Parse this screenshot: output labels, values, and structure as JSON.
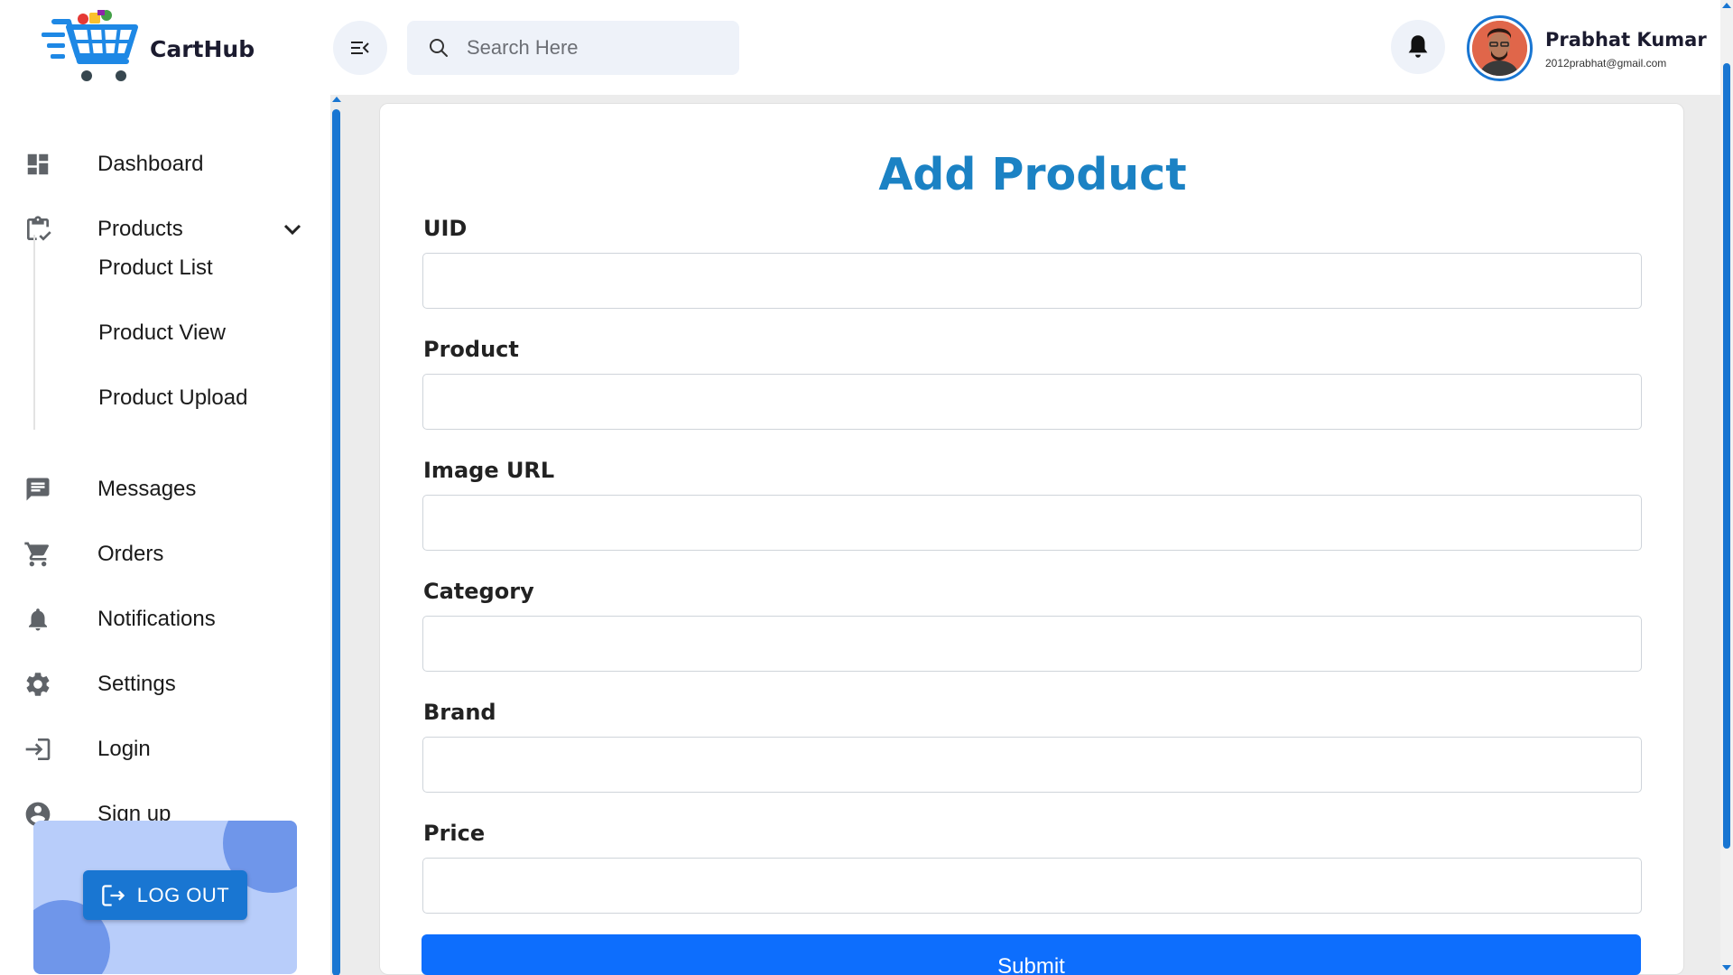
{
  "app": {
    "brand": "CartHub"
  },
  "header": {
    "search_placeholder": "Search Here",
    "user": {
      "name": "Prabhat Kumar",
      "email": "2012prabhat@gmail.com"
    }
  },
  "sidebar": {
    "items": [
      {
        "label": "Dashboard",
        "icon": "dashboard-icon"
      },
      {
        "label": "Products",
        "icon": "clipboard-check-icon",
        "expanded": true
      },
      {
        "label": "Messages",
        "icon": "message-icon"
      },
      {
        "label": "Orders",
        "icon": "cart-icon"
      },
      {
        "label": "Notifications",
        "icon": "bell-icon"
      },
      {
        "label": "Settings",
        "icon": "gear-icon"
      },
      {
        "label": "Login",
        "icon": "login-icon"
      },
      {
        "label": "Sign up",
        "icon": "account-circle-icon"
      }
    ],
    "submenu": [
      {
        "label": "Product List"
      },
      {
        "label": "Product View"
      },
      {
        "label": "Product Upload"
      }
    ],
    "logout_label": "LOG OUT"
  },
  "form": {
    "title": "Add Product",
    "fields": [
      {
        "label": "UID",
        "value": ""
      },
      {
        "label": "Product",
        "value": ""
      },
      {
        "label": "Image URL",
        "value": ""
      },
      {
        "label": "Category",
        "value": ""
      },
      {
        "label": "Brand",
        "value": ""
      },
      {
        "label": "Price",
        "value": ""
      }
    ],
    "submit_label": "Submit"
  },
  "colors": {
    "accent": "#1976d2",
    "title": "#1b82c4",
    "submit": "#0d6efd",
    "card_bg": "#b8cdfa"
  }
}
